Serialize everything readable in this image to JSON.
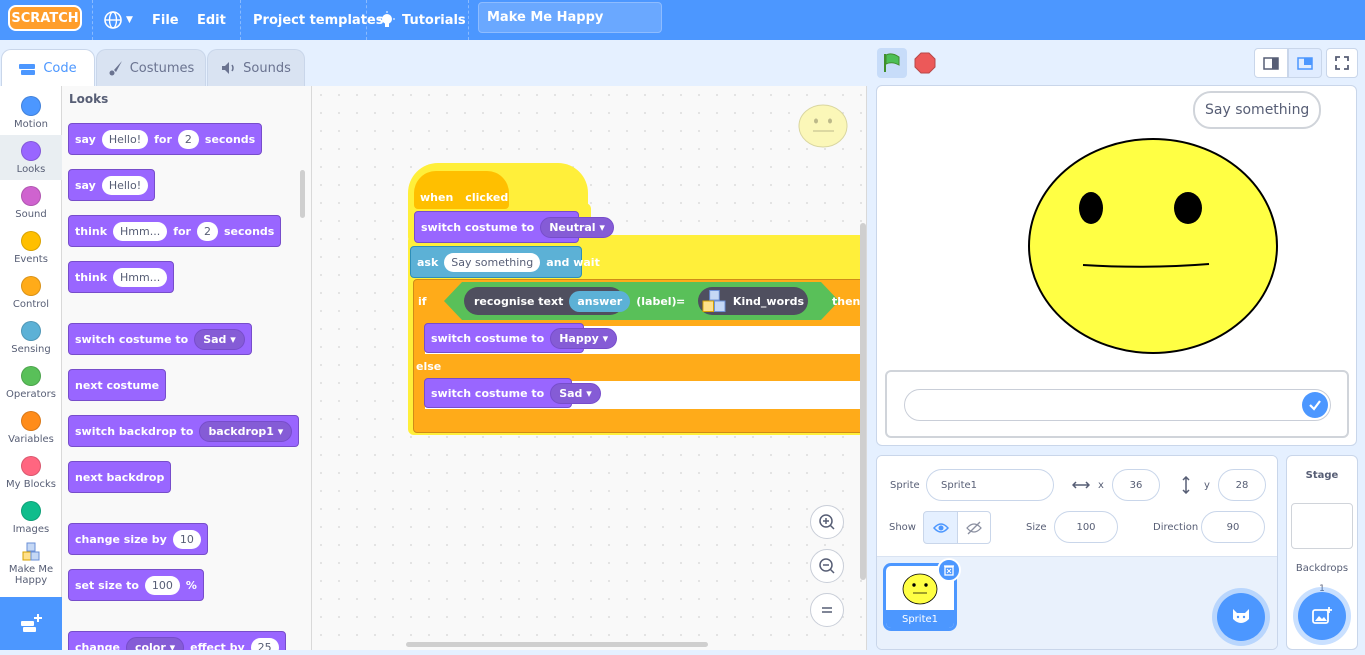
{
  "menubar": {
    "logo": "SCRATCH",
    "file": "File",
    "edit": "Edit",
    "project_templates": "Project templates",
    "tutorials": "Tutorials",
    "project_title": "Make Me Happy"
  },
  "tabs": {
    "code": "Code",
    "costumes": "Costumes",
    "sounds": "Sounds"
  },
  "categories": [
    {
      "label": "Motion",
      "color": "#4c97ff"
    },
    {
      "label": "Looks",
      "color": "#9966ff"
    },
    {
      "label": "Sound",
      "color": "#cf63cf"
    },
    {
      "label": "Events",
      "color": "#ffbf00"
    },
    {
      "label": "Control",
      "color": "#ffab19"
    },
    {
      "label": "Sensing",
      "color": "#5cb1d6"
    },
    {
      "label": "Operators",
      "color": "#59c059"
    },
    {
      "label": "Variables",
      "color": "#ff8c1a"
    },
    {
      "label": "My Blocks",
      "color": "#ff6680"
    },
    {
      "label": "Images",
      "color": "#0fbd8c"
    },
    {
      "label": "Make Me Happy",
      "color": ""
    }
  ],
  "palette": {
    "heading": "Looks",
    "say_for": {
      "say": "say",
      "text": "Hello!",
      "for": "for",
      "num": "2",
      "seconds": "seconds"
    },
    "say": {
      "say": "say",
      "text": "Hello!"
    },
    "think_for": {
      "think": "think",
      "text": "Hmm...",
      "for": "for",
      "num": "2",
      "seconds": "seconds"
    },
    "think": {
      "think": "think",
      "text": "Hmm..."
    },
    "switch_costume": {
      "label": "switch costume to",
      "value": "Sad"
    },
    "next_costume": "next costume",
    "switch_backdrop": {
      "label": "switch backdrop to",
      "value": "backdrop1"
    },
    "next_backdrop": "next backdrop",
    "change_size": {
      "label": "change size by",
      "value": "10"
    },
    "set_size": {
      "label": "set size to",
      "value": "100",
      "unit": "%"
    },
    "change_effect": {
      "label": "change",
      "value": "color",
      "by": "effect by",
      "num": "25"
    }
  },
  "script": {
    "when": "when",
    "clicked": "clicked",
    "switch1": {
      "label": "switch costume to",
      "value": "Neutral"
    },
    "ask": {
      "label": "ask",
      "text": "Say something",
      "wait": "and wait"
    },
    "if": "if",
    "recognise": "recognise text",
    "answer": "answer",
    "label": "(label)",
    "equals": "=",
    "kind_words": "Kind_words",
    "then": "then",
    "switch2": {
      "label": "switch costume to",
      "value": "Happy"
    },
    "else": "else",
    "switch3": {
      "label": "switch costume to",
      "value": "Sad"
    }
  },
  "stage": {
    "speech": "Say something"
  },
  "sprite_info": {
    "sprite_label": "Sprite",
    "sprite_name": "Sprite1",
    "x_label": "x",
    "x": "36",
    "y_label": "y",
    "y": "28",
    "show_label": "Show",
    "size_label": "Size",
    "size": "100",
    "direction_label": "Direction",
    "direction": "90"
  },
  "sprite_list": [
    {
      "name": "Sprite1"
    }
  ],
  "stage_pane": {
    "title": "Stage",
    "backdrops_label": "Backdrops",
    "backdrops_count": "1"
  },
  "colors": {
    "menubar": "#4c97ff",
    "looks": "#9966ff",
    "control": "#ffab19",
    "events": "#ffbf00",
    "operators": "#59c059",
    "sensing": "#5cb1d6"
  }
}
